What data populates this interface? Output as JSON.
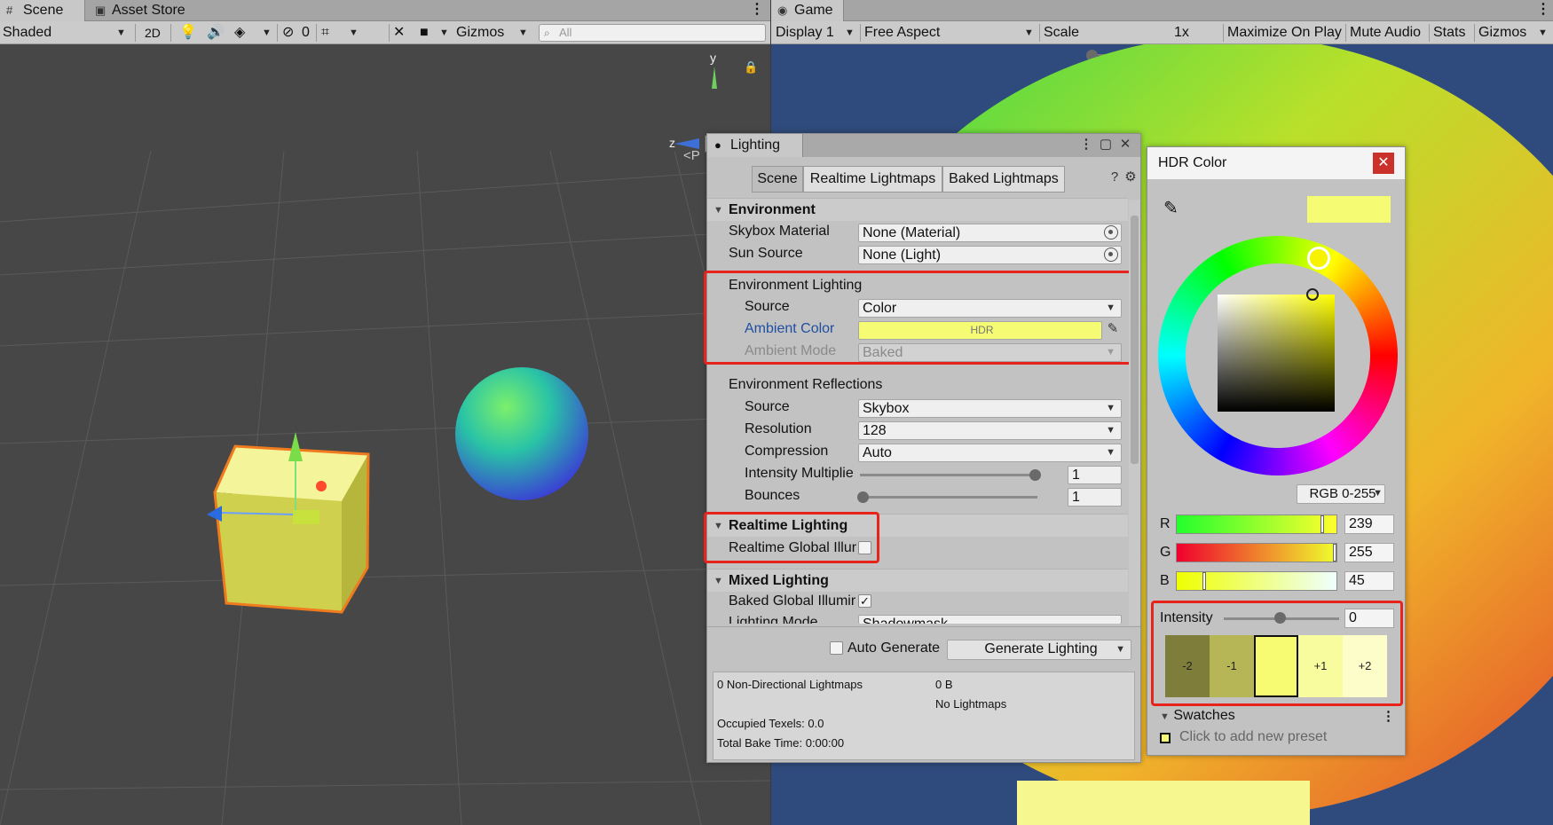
{
  "scene": {
    "tabs": [
      {
        "label": "Scene",
        "icon": "grid-icon"
      },
      {
        "label": "Asset Store",
        "icon": "bag-icon"
      }
    ],
    "shading": "Shaded",
    "toggle_2d": "2D",
    "hidden_count": "0",
    "gizmos": "Gizmos",
    "search_placeholder": "All",
    "persp_label": "<P",
    "axis_labels": {
      "y": "y",
      "z": "z"
    }
  },
  "game": {
    "tab": "Game",
    "display": "Display 1",
    "aspect": "Free Aspect",
    "scale_label": "Scale",
    "scale_value": "1x",
    "maximize": "Maximize On Play",
    "mute": "Mute Audio",
    "stats": "Stats",
    "gizmos": "Gizmos"
  },
  "lighting": {
    "title": "Lighting",
    "tabs": [
      "Scene",
      "Realtime Lightmaps",
      "Baked Lightmaps"
    ],
    "environment": {
      "header": "Environment",
      "skybox_label": "Skybox Material",
      "skybox_value": "None (Material)",
      "sun_label": "Sun Source",
      "sun_value": "None (Light)",
      "lighting_header": "Environment Lighting",
      "source_label": "Source",
      "source_value": "Color",
      "ambient_color_label": "Ambient Color",
      "ambient_color_value": "HDR",
      "ambient_color": "#f5fb72",
      "ambient_mode_label": "Ambient Mode",
      "ambient_mode_value": "Baked",
      "reflections_header": "Environment Reflections",
      "refl_source_label": "Source",
      "refl_source_value": "Skybox",
      "resolution_label": "Resolution",
      "resolution_value": "128",
      "compression_label": "Compression",
      "compression_value": "Auto",
      "intensity_label": "Intensity Multiplie",
      "intensity_value": "1",
      "bounces_label": "Bounces",
      "bounces_value": "1"
    },
    "realtime": {
      "header": "Realtime Lighting",
      "gi_label": "Realtime Global Illur",
      "gi_checked": false
    },
    "mixed": {
      "header": "Mixed Lighting",
      "baked_gi_label": "Baked Global Illumir",
      "baked_gi_checked": true,
      "mode_label": "Lighting Mode",
      "mode_value": "Shadowmask"
    },
    "auto_generate_label": "Auto Generate",
    "generate_button": "Generate Lighting",
    "info": {
      "lightmaps": "0 Non-Directional Lightmaps",
      "size": "0 B",
      "no_lightmaps": "No Lightmaps",
      "texels": "Occupied Texels: 0.0",
      "bake_time": "Total Bake Time: 0:00:00"
    }
  },
  "hdr_color": {
    "title": "HDR Color",
    "mode": "RGB 0-255",
    "r_label": "R",
    "r_value": "239",
    "g_label": "G",
    "g_value": "255",
    "b_label": "B",
    "b_value": "45",
    "intensity_label": "Intensity",
    "intensity_value": "0",
    "presets": [
      "-2",
      "-1",
      "",
      "+1",
      "+2"
    ],
    "preset_colors": [
      "#7e7d3a",
      "#b6b657",
      "#f7fb72",
      "#f9fc9e",
      "#fcfdc8"
    ],
    "swatches_label": "Swatches",
    "swatches_hint": "Click to add new preset"
  }
}
